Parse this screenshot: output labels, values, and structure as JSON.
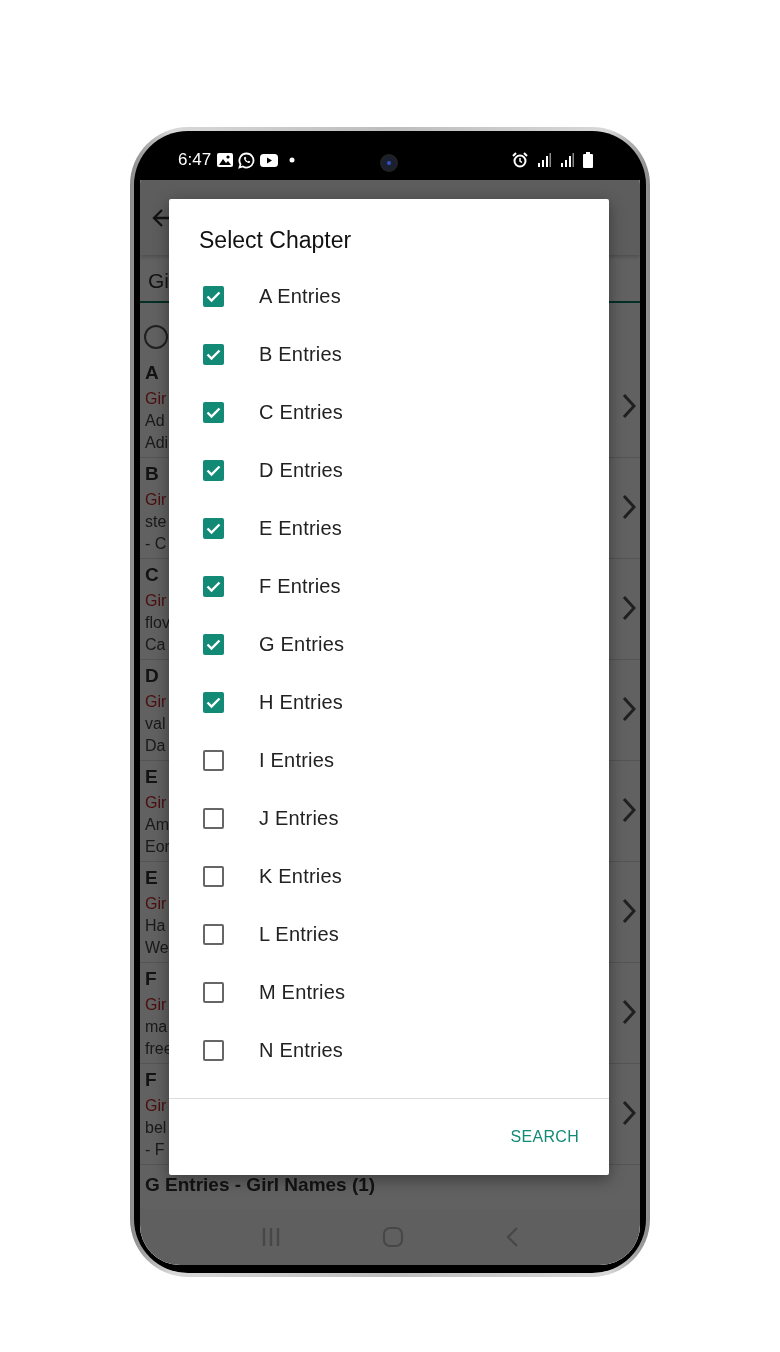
{
  "status_bar": {
    "time": "6:47"
  },
  "app": {
    "tab": "Gi",
    "radio": {
      "selected": false
    },
    "entries": [
      {
        "heading": "A",
        "tag": "Gir",
        "lines": [
          "Ad",
          "Adi"
        ]
      },
      {
        "heading": "B",
        "tag": "Gir",
        "lines": [
          "ste",
          "- C"
        ]
      },
      {
        "heading": "C",
        "tag": "Gir",
        "lines": [
          "flov",
          "Ca"
        ]
      },
      {
        "heading": "D",
        "tag": "Gir",
        "lines": [
          "val",
          "Da"
        ]
      },
      {
        "heading": "E",
        "tag": "Gir",
        "lines": [
          "Am",
          "Eor"
        ]
      },
      {
        "heading": "E",
        "tag": "Gir",
        "lines": [
          "Ha",
          "We"
        ]
      },
      {
        "heading": "F",
        "tag": "Gir",
        "lines": [
          "ma",
          "free"
        ]
      },
      {
        "heading": "F",
        "tag": "Gir",
        "lines": [
          "bel",
          "- F"
        ]
      }
    ],
    "footer_heading": "G Entries - Girl Names (1)"
  },
  "dialog": {
    "title": "Select Chapter",
    "chapters": [
      {
        "label": "A Entries",
        "checked": true
      },
      {
        "label": "B Entries",
        "checked": true
      },
      {
        "label": "C Entries",
        "checked": true
      },
      {
        "label": "D Entries",
        "checked": true
      },
      {
        "label": "E Entries",
        "checked": true
      },
      {
        "label": "F Entries",
        "checked": true
      },
      {
        "label": "G Entries",
        "checked": true
      },
      {
        "label": "H Entries",
        "checked": true
      },
      {
        "label": "I Entries",
        "checked": false
      },
      {
        "label": "J Entries",
        "checked": false
      },
      {
        "label": "K Entries",
        "checked": false
      },
      {
        "label": "L Entries",
        "checked": false
      },
      {
        "label": "M Entries",
        "checked": false
      },
      {
        "label": "N Entries",
        "checked": false
      }
    ],
    "buttons": [
      "SEARCH"
    ]
  }
}
